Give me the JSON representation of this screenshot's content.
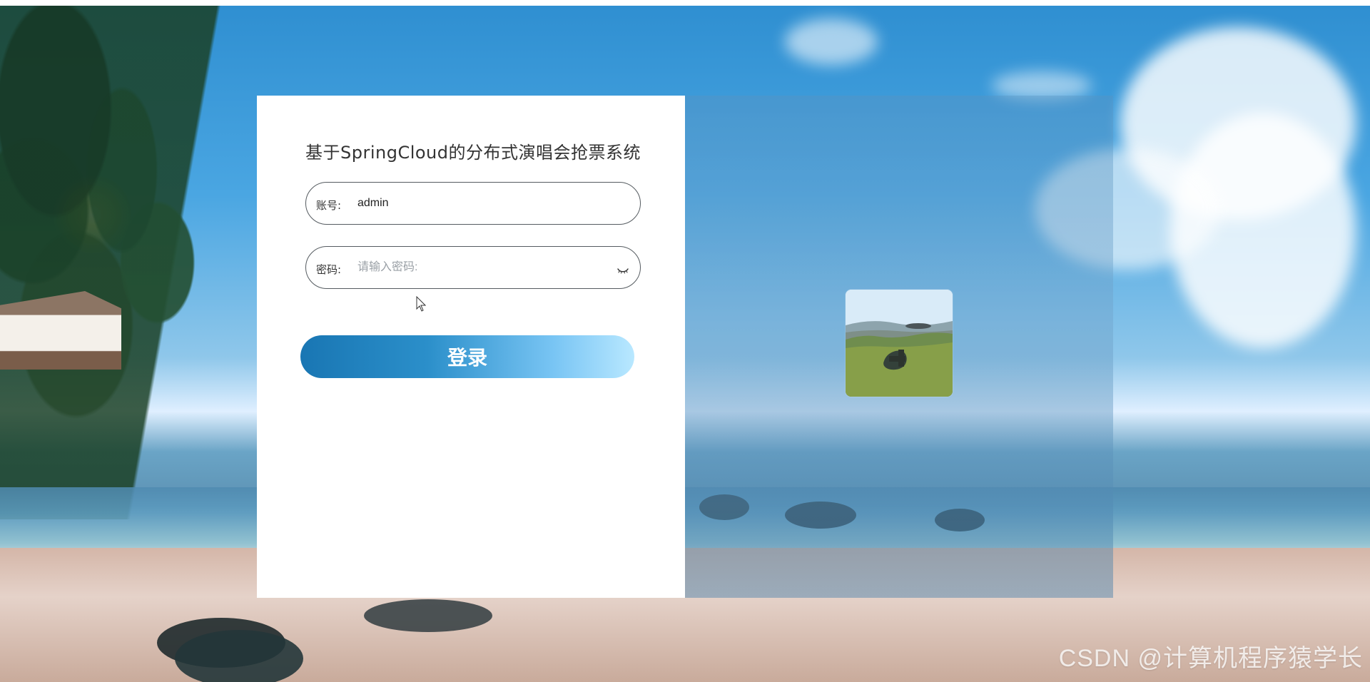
{
  "app": {
    "title": "基于SpringCloud的分布式演唱会抢票系统"
  },
  "form": {
    "username_label": "账号:",
    "username_value": "admin",
    "password_label": "密码:",
    "password_placeholder": "请输入密码:",
    "login_button": "登录"
  },
  "icons": {
    "password_toggle": "eye-icon",
    "cursor": "cursor-icon"
  },
  "watermark": {
    "text": "CSDN @计算机程序猿学长"
  },
  "colors": {
    "button_start": "#1976b3",
    "button_end": "#b9e8ff",
    "title_text": "#333333",
    "field_border": "#555b60"
  }
}
